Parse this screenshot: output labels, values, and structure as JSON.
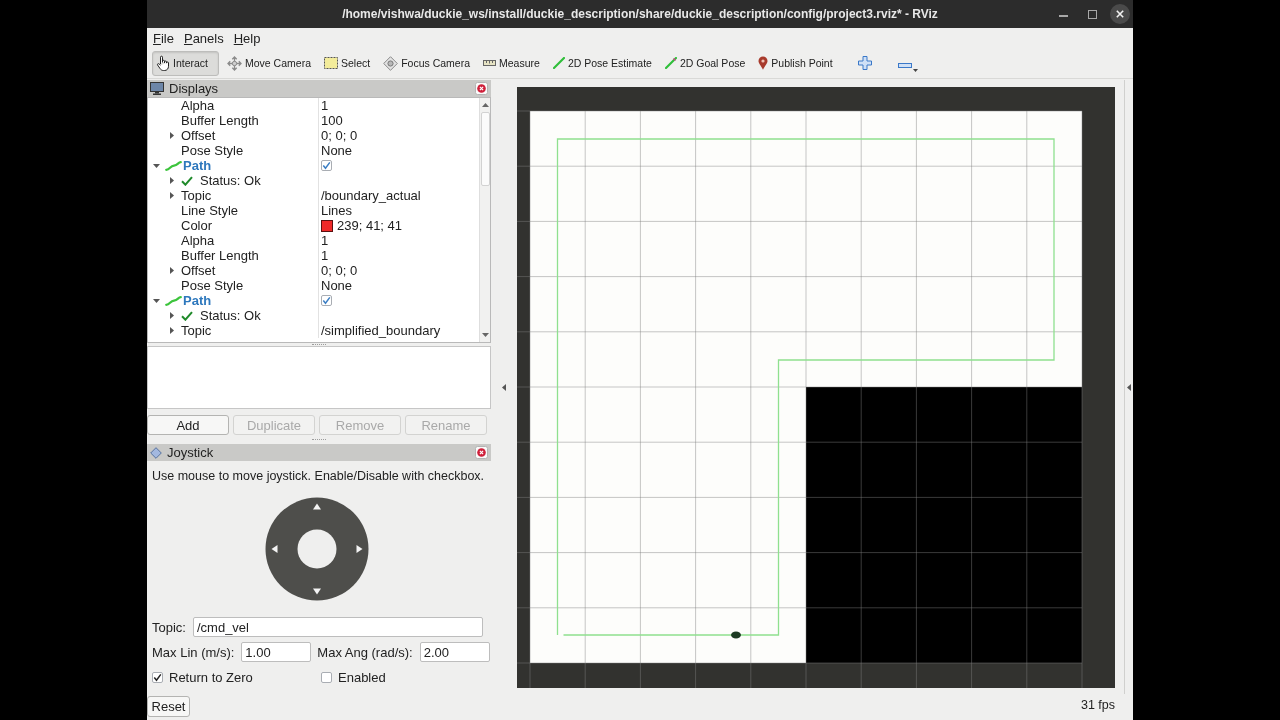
{
  "window": {
    "title": "/home/vishwa/duckie_ws/install/duckie_description/share/duckie_description/config/project3.rviz* - RViz"
  },
  "menu": [
    {
      "label": "File"
    },
    {
      "label": "Panels"
    },
    {
      "label": "Help"
    }
  ],
  "tools": [
    {
      "kind": "interact",
      "label": "Interact",
      "selected": true
    },
    {
      "kind": "move_camera",
      "label": "Move Camera",
      "selected": false
    },
    {
      "kind": "select",
      "label": "Select",
      "selected": false
    },
    {
      "kind": "focus_camera",
      "label": "Focus Camera",
      "selected": false
    },
    {
      "kind": "measure",
      "label": "Measure",
      "selected": false
    },
    {
      "kind": "pose_estimate",
      "label": "2D Pose Estimate",
      "selected": false
    },
    {
      "kind": "goal_pose",
      "label": "2D Goal Pose",
      "selected": false
    },
    {
      "kind": "publish_point",
      "label": "Publish Point",
      "selected": false
    }
  ],
  "displays_panel": {
    "title": "Displays",
    "tree": [
      {
        "children": [
          {
            "kind": "property",
            "name": "Alpha",
            "value": "1"
          },
          {
            "kind": "property",
            "name": "Buffer Length",
            "value": "100"
          },
          {
            "kind": "property",
            "name": "Offset",
            "value": "0; 0; 0",
            "expanded": false
          },
          {
            "kind": "property",
            "name": "Pose Style",
            "value": "None"
          }
        ]
      },
      {
        "kind": "display",
        "name": "Path",
        "checked": true,
        "expanded": true,
        "children": [
          {
            "kind": "status",
            "name": "Status: Ok",
            "expanded": false
          },
          {
            "kind": "property",
            "name": "Topic",
            "value": "/boundary_actual",
            "expanded": false
          },
          {
            "kind": "property",
            "name": "Line Style",
            "value": "Lines"
          },
          {
            "kind": "color",
            "name": "Color",
            "value": "239; 41; 41",
            "color": "#ef2929"
          },
          {
            "kind": "property",
            "name": "Alpha",
            "value": "1"
          },
          {
            "kind": "property",
            "name": "Buffer Length",
            "value": "1"
          },
          {
            "kind": "property",
            "name": "Offset",
            "value": "0; 0; 0",
            "expanded": false
          },
          {
            "kind": "property",
            "name": "Pose Style",
            "value": "None"
          }
        ]
      },
      {
        "kind": "display",
        "name": "Path",
        "checked": true,
        "expanded": true,
        "children": [
          {
            "kind": "status",
            "name": "Status: Ok",
            "expanded": false
          },
          {
            "kind": "property",
            "name": "Topic",
            "value": "/simplified_boundary",
            "expanded": false
          }
        ]
      }
    ],
    "buttons": [
      {
        "label": "Add",
        "disabled": false
      },
      {
        "label": "Duplicate",
        "disabled": true
      },
      {
        "label": "Remove",
        "disabled": true
      },
      {
        "label": "Rename",
        "disabled": true
      }
    ]
  },
  "joystick_panel": {
    "title": "Joystick",
    "hint": "Use mouse to move joystick. Enable/Disable with checkbox.",
    "topic": {
      "label": "Topic:",
      "value": "/cmd_vel"
    },
    "limits": [
      {
        "label": "Max Lin (m/s):",
        "value": "1.00"
      },
      {
        "label": "Max Ang (rad/s):",
        "value": "2.00"
      }
    ],
    "options": [
      {
        "label": "Return to Zero",
        "checked": true
      },
      {
        "label": "Enabled",
        "checked": false
      }
    ],
    "reset_button": "Reset"
  },
  "view": {
    "fps": "31 fps"
  }
}
